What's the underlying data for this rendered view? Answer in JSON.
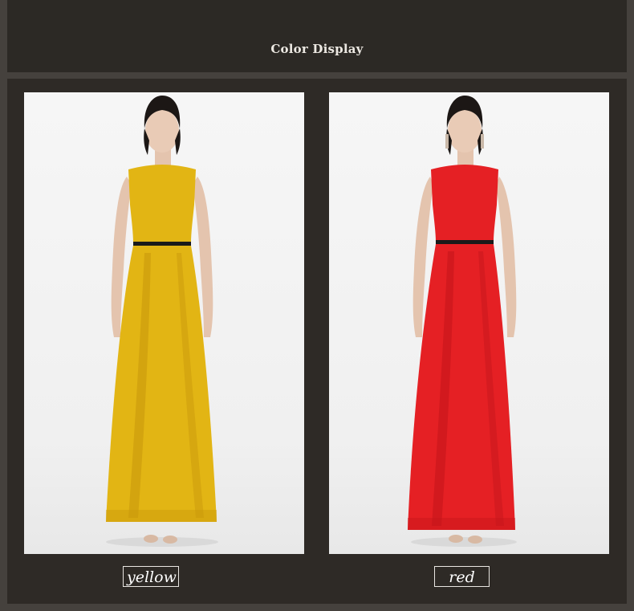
{
  "header": {
    "title": "Color Display"
  },
  "products": [
    {
      "color_name": "yellow",
      "dress_color": "#e2b514",
      "dress_shade": "#c99a0b"
    },
    {
      "color_name": "red",
      "dress_color": "#e52024",
      "dress_shade": "#c5161b"
    }
  ],
  "colors": {
    "page_background": "#45413d",
    "panel_background": "#2e2a26",
    "header_background": "#2c2925",
    "text": "#ece8e2"
  }
}
